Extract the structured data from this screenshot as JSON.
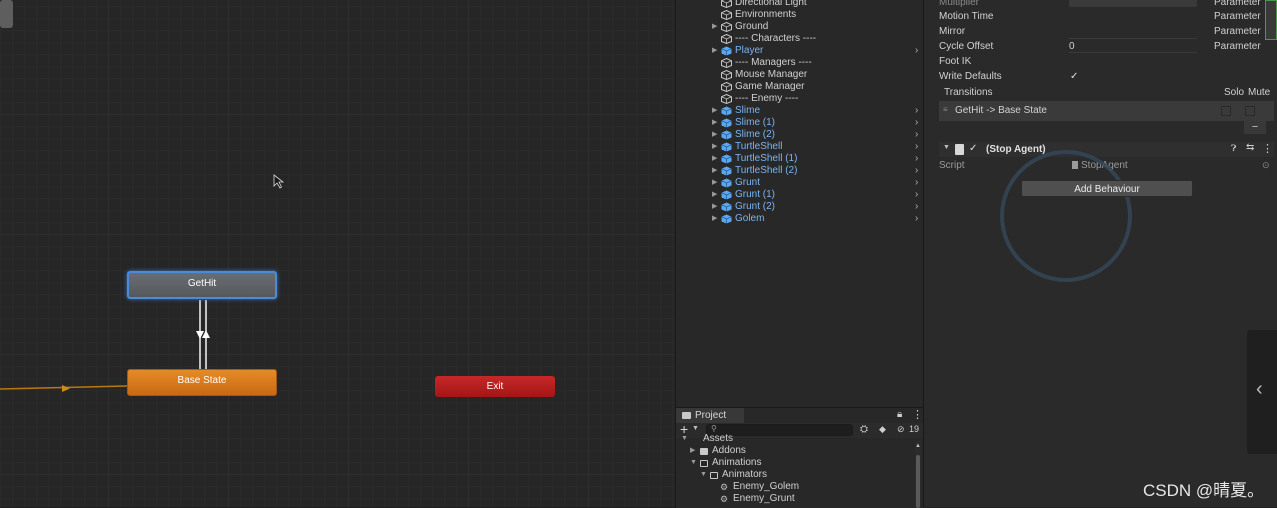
{
  "animator": {
    "states": {
      "gethit": "GetHit",
      "base": "Base State",
      "exit": "Exit"
    }
  },
  "hierarchy": {
    "items": [
      {
        "label": "Directional Light",
        "prefab": false,
        "expandable": false
      },
      {
        "label": "Environments",
        "prefab": false,
        "expandable": false
      },
      {
        "label": "Ground",
        "prefab": false,
        "expandable": true
      },
      {
        "label": "---- Characters ----",
        "prefab": false,
        "expandable": false
      },
      {
        "label": "Player",
        "prefab": true,
        "expandable": true
      },
      {
        "label": "---- Managers ----",
        "prefab": false,
        "expandable": false
      },
      {
        "label": "Mouse Manager",
        "prefab": false,
        "expandable": false
      },
      {
        "label": "Game Manager",
        "prefab": false,
        "expandable": false
      },
      {
        "label": "---- Enemy ----",
        "prefab": false,
        "expandable": false
      },
      {
        "label": "Slime",
        "prefab": true,
        "expandable": true
      },
      {
        "label": "Slime (1)",
        "prefab": true,
        "expandable": true
      },
      {
        "label": "Slime (2)",
        "prefab": true,
        "expandable": true
      },
      {
        "label": "TurtleShell",
        "prefab": true,
        "expandable": true
      },
      {
        "label": "TurtleShell (1)",
        "prefab": true,
        "expandable": true
      },
      {
        "label": "TurtleShell (2)",
        "prefab": true,
        "expandable": true
      },
      {
        "label": "Grunt",
        "prefab": true,
        "expandable": true
      },
      {
        "label": "Grunt (1)",
        "prefab": true,
        "expandable": true
      },
      {
        "label": "Grunt (2)",
        "prefab": true,
        "expandable": true
      },
      {
        "label": "Golem",
        "prefab": true,
        "expandable": true
      }
    ]
  },
  "project": {
    "tab": "Project",
    "hidden_count": "19",
    "items": [
      {
        "label": "Assets"
      },
      {
        "label": "Addons"
      },
      {
        "label": "Animations"
      },
      {
        "label": "Animators"
      },
      {
        "label": "Enemy_Golem"
      },
      {
        "label": "Enemy_Grunt"
      }
    ]
  },
  "inspector": {
    "multiplier": "Multiplier",
    "motion_time": "Motion Time",
    "mirror": "Mirror",
    "cycle_offset": "Cycle Offset",
    "cycle_offset_value": "0",
    "foot_ik": "Foot IK",
    "write_defaults": "Write Defaults",
    "write_defaults_check": "✓",
    "parameter": "Parameter",
    "transitions": "Transitions",
    "solo": "Solo",
    "mute": "Mute",
    "transition_item": "GetHit -> Base State",
    "minus": "−",
    "component_title": "(Stop Agent)",
    "script_label": "Script",
    "script_value": "StopAgent",
    "add_behaviour": "Add Behaviour"
  },
  "watermark": "CSDN @晴夏。",
  "colors": {
    "selected_state_border": "#4a8cd8",
    "base_state": "#d97a1f",
    "exit_state": "#b71c1c",
    "prefab_text": "#7cb4ee",
    "transition_line": "#b87a10"
  }
}
